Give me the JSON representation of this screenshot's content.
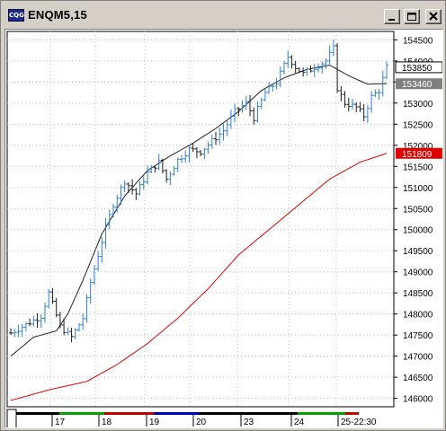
{
  "window": {
    "title": "ENQM5,15",
    "icon_name": "chart-app-icon",
    "icon_text": "CQG",
    "buttons": [
      "minimize-icon",
      "maximize-icon",
      "close-icon"
    ]
  },
  "colors": {
    "up_bar": "#2f7fd8",
    "down_bar": "#202020",
    "ma_short": "#202020",
    "ma_long": "#e00000",
    "grid": "#bfbfbf",
    "tag_current": "#7f7f7f",
    "tag_ma_short": "#7f7f7f",
    "tag_ma_long": "#e00000"
  },
  "chart_data": {
    "type": "ohlc",
    "symbol": "ENQM5",
    "interval_minutes": 15,
    "ylim": [
      14580,
      15470
    ],
    "y_ticks": [
      14600,
      14650,
      14700,
      14750,
      14800,
      14850,
      14900,
      14950,
      15000,
      15050,
      15100,
      15150,
      15200,
      15250,
      15300,
      15350,
      15400,
      15450
    ],
    "y_tick_labels": [
      "146000",
      "146500",
      "147000",
      "147500",
      "148000",
      "148500",
      "149000",
      "149500",
      "150000",
      "150500",
      "151000",
      "151500",
      "152000",
      "152500",
      "153000",
      "153500",
      "154000",
      "154500"
    ],
    "price_tags": [
      {
        "label": "153850",
        "value": 15385,
        "role": "last-price"
      },
      {
        "label": "153460",
        "value": 15346,
        "role": "short-ma"
      },
      {
        "label": "151809",
        "value": 15180.9,
        "role": "long-ma"
      }
    ],
    "sessions": [
      "",
      "17",
      "18",
      "19",
      "20",
      "23",
      "24",
      "25-22:30"
    ],
    "session_colors": [
      "#000000",
      "#000000",
      "#00a000",
      "#c00000",
      "#0000c0",
      "#000000",
      "#000000",
      "#00a000",
      "#c00000"
    ],
    "price_path": [
      [
        0,
        14755
      ],
      [
        4,
        14775
      ],
      [
        8,
        14795
      ],
      [
        10,
        14850
      ],
      [
        13,
        14770
      ],
      [
        16,
        14745
      ],
      [
        19,
        14790
      ],
      [
        21,
        14875
      ],
      [
        25,
        15005
      ],
      [
        27,
        15060
      ],
      [
        30,
        15115
      ],
      [
        33,
        15085
      ],
      [
        36,
        15135
      ],
      [
        39,
        15160
      ],
      [
        41,
        15120
      ],
      [
        44,
        15165
      ],
      [
        47,
        15190
      ],
      [
        50,
        15185
      ],
      [
        53,
        15210
      ],
      [
        56,
        15235
      ],
      [
        59,
        15280
      ],
      [
        62,
        15300
      ],
      [
        64,
        15265
      ],
      [
        67,
        15325
      ],
      [
        70,
        15350
      ],
      [
        73,
        15410
      ],
      [
        75,
        15385
      ],
      [
        77,
        15370
      ],
      [
        80,
        15385
      ],
      [
        83,
        15400
      ],
      [
        85,
        15430
      ],
      [
        86,
        15335
      ],
      [
        88,
        15300
      ],
      [
        91,
        15290
      ],
      [
        93,
        15270
      ],
      [
        95,
        15315
      ],
      [
        97,
        15330
      ],
      [
        99,
        15385
      ]
    ],
    "ma_short": [
      [
        0,
        14700
      ],
      [
        6,
        14745
      ],
      [
        12,
        14760
      ],
      [
        15,
        14800
      ],
      [
        19,
        14880
      ],
      [
        24,
        14990
      ],
      [
        30,
        15080
      ],
      [
        36,
        15140
      ],
      [
        42,
        15175
      ],
      [
        48,
        15205
      ],
      [
        54,
        15240
      ],
      [
        60,
        15280
      ],
      [
        66,
        15330
      ],
      [
        72,
        15360
      ],
      [
        78,
        15380
      ],
      [
        84,
        15390
      ],
      [
        89,
        15365
      ],
      [
        94,
        15345
      ],
      [
        99,
        15346
      ]
    ],
    "ma_long": [
      [
        0,
        14595
      ],
      [
        10,
        14620
      ],
      [
        20,
        14640
      ],
      [
        28,
        14680
      ],
      [
        36,
        14730
      ],
      [
        44,
        14790
      ],
      [
        52,
        14860
      ],
      [
        60,
        14940
      ],
      [
        68,
        15000
      ],
      [
        76,
        15060
      ],
      [
        84,
        15120
      ],
      [
        92,
        15160
      ],
      [
        99,
        15181
      ]
    ]
  }
}
